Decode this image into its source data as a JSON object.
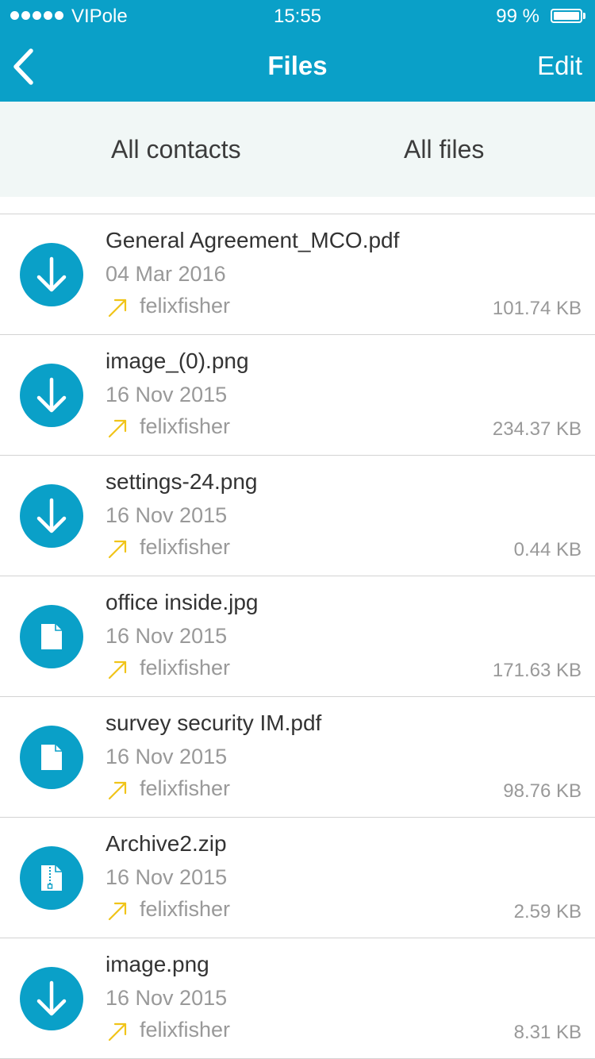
{
  "status_bar": {
    "carrier": "VIPole",
    "time": "15:55",
    "battery": "99 %",
    "signal_bars": 5
  },
  "nav": {
    "back_icon": "chevron-left-icon",
    "title": "Files",
    "edit_label": "Edit"
  },
  "filters": {
    "contacts_label": "All contacts",
    "files_label": "All files"
  },
  "colors": {
    "accent": "#0aa0c8",
    "filter_background": "#f1f7f6",
    "outgoing_arrow": "#f0c419"
  },
  "files": [
    {
      "name": "General Agreement_MCO.pdf",
      "date": "04 Mar 2016",
      "sender": "felixfisher",
      "size": "101.74 KB",
      "icon": "download-icon",
      "direction_icon": "outgoing-arrow-icon"
    },
    {
      "name": "image_(0).png",
      "date": "16 Nov 2015",
      "sender": "felixfisher",
      "size": "234.37 KB",
      "icon": "download-icon",
      "direction_icon": "outgoing-arrow-icon"
    },
    {
      "name": "settings-24.png",
      "date": "16 Nov 2015",
      "sender": "felixfisher",
      "size": "0.44 KB",
      "icon": "download-icon",
      "direction_icon": "outgoing-arrow-icon"
    },
    {
      "name": "office inside.jpg",
      "date": "16 Nov 2015",
      "sender": "felixfisher",
      "size": "171.63 KB",
      "icon": "document-icon",
      "direction_icon": "outgoing-arrow-icon"
    },
    {
      "name": "survey security IM.pdf",
      "date": "16 Nov 2015",
      "sender": "felixfisher",
      "size": "98.76 KB",
      "icon": "document-icon",
      "direction_icon": "outgoing-arrow-icon"
    },
    {
      "name": "Archive2.zip",
      "date": "16 Nov 2015",
      "sender": "felixfisher",
      "size": "2.59 KB",
      "icon": "archive-icon",
      "direction_icon": "outgoing-arrow-icon"
    },
    {
      "name": "image.png",
      "date": "16 Nov 2015",
      "sender": "felixfisher",
      "size": "8.31 KB",
      "icon": "download-icon",
      "direction_icon": "outgoing-arrow-icon"
    }
  ]
}
